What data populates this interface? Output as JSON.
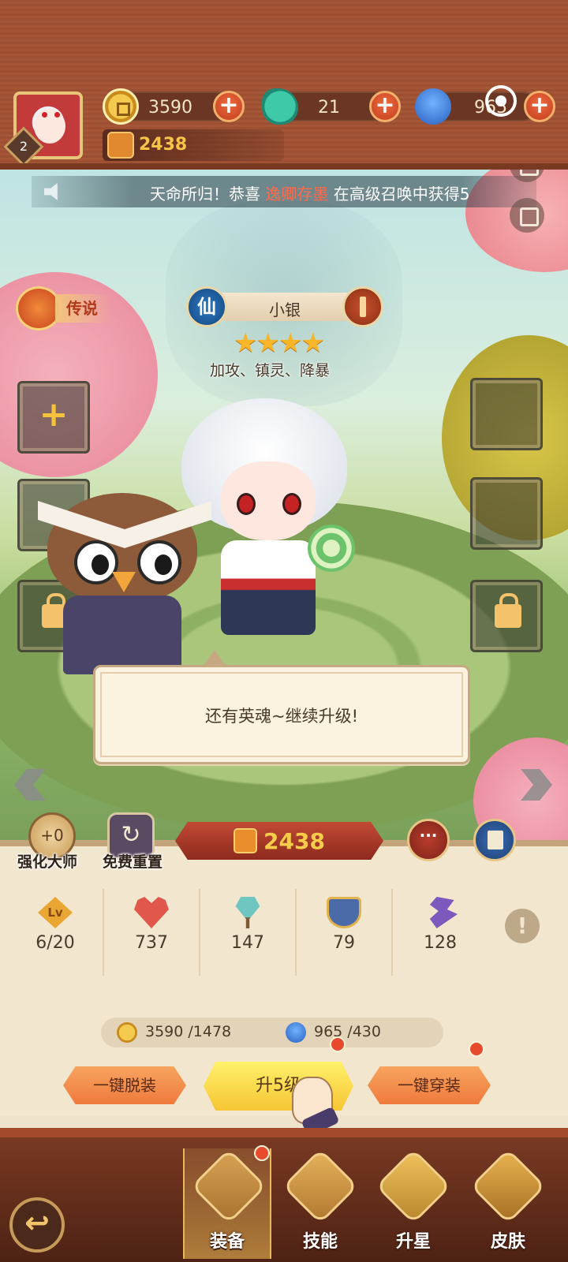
{
  "player": {
    "level": "2"
  },
  "resources": {
    "gold": "3590",
    "jade": "21",
    "spirit": "965"
  },
  "header_power": "2438",
  "notice": {
    "prefix": "天命所归！恭喜 ",
    "highlight": "逸卿存墨",
    "suffix": " 在高级召唤中获得5"
  },
  "hero": {
    "rarity": "传说",
    "faction_glyph": "仙",
    "name": "小银",
    "stars": "★★★★",
    "tags": "加攻、镇灵、降暴"
  },
  "speech": "还有英魂~继续升级!",
  "actions": {
    "enhance_value": "+0",
    "enhance_label": "强化大师",
    "reset_label": "免费重置",
    "power": "2438"
  },
  "stats": {
    "level_icon_text": "Lv",
    "level": "6/20",
    "hp": "737",
    "attack": "147",
    "defense": "79",
    "speed": "128"
  },
  "info_glyph": "!",
  "cost": {
    "gold": "3590 /1478",
    "spirit": "965 /430"
  },
  "buttons": {
    "unequip_all": "一键脱装",
    "upgrade": "升5级",
    "equip_all": "一键穿装"
  },
  "nav": {
    "tabs": [
      {
        "label": "装备",
        "icon": "armor-icon"
      },
      {
        "label": "技能",
        "icon": "scroll-icon"
      },
      {
        "label": "升星",
        "icon": "star-badge-icon"
      },
      {
        "label": "皮肤",
        "icon": "skin-icon"
      }
    ]
  },
  "colors": {
    "accent": "#f7c44a",
    "notice_highlight": "#ff6b4a",
    "notification": "#e74a2c"
  }
}
